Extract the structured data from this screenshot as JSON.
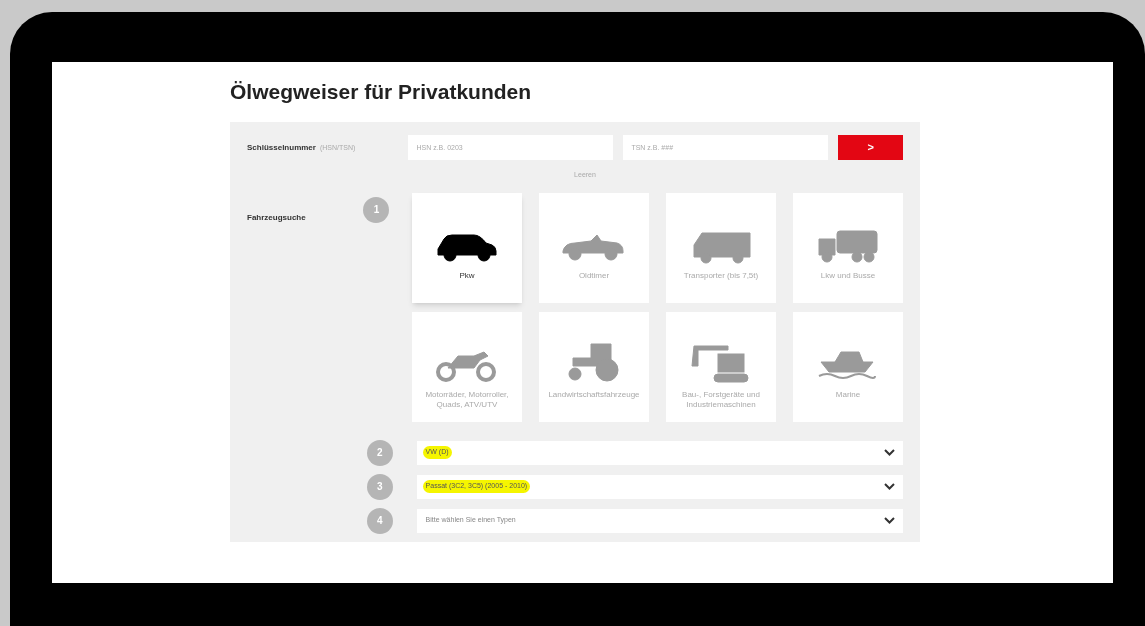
{
  "title": "Ölwegweiser für Privatkunden",
  "key_number": {
    "label": "Schlüsselnummer",
    "hint": "(HSN/TSN)",
    "fields": [
      {
        "placeholder": "HSN z.B. 0203"
      },
      {
        "placeholder": "TSN z.B. ###"
      }
    ],
    "submit": ">",
    "reset": "Leeren"
  },
  "vehicle_search": {
    "label": "Fahrzeugsuche",
    "step": "1",
    "categories": [
      {
        "kind": "car",
        "label": "Pkw",
        "selected": true
      },
      {
        "kind": "vintage",
        "label": "Oldtimer",
        "selected": false
      },
      {
        "kind": "van",
        "label": "Transporter (bis 7,5t)",
        "selected": false
      },
      {
        "kind": "truck",
        "label": "Lkw und Busse",
        "selected": false
      },
      {
        "kind": "motorbike",
        "label": "Motorräder, Motorroller, Quads, ATV/UTV",
        "selected": false
      },
      {
        "kind": "tractor",
        "label": "Landwirtschaftsfahrzeuge",
        "selected": false
      },
      {
        "kind": "excavator",
        "label": "Bau-, Forstgeräte und Industriemaschinen",
        "selected": false
      },
      {
        "kind": "boat",
        "label": "Marine",
        "selected": false
      }
    ]
  },
  "selects": [
    {
      "step": "2",
      "value": "VW (D)",
      "highlighted": true
    },
    {
      "step": "3",
      "value": "Passat (3C2, 3C5) (2005 - 2010)",
      "highlighted": true
    },
    {
      "step": "4",
      "value": "Bitte wählen Sie einen Typen",
      "highlighted": false
    }
  ]
}
